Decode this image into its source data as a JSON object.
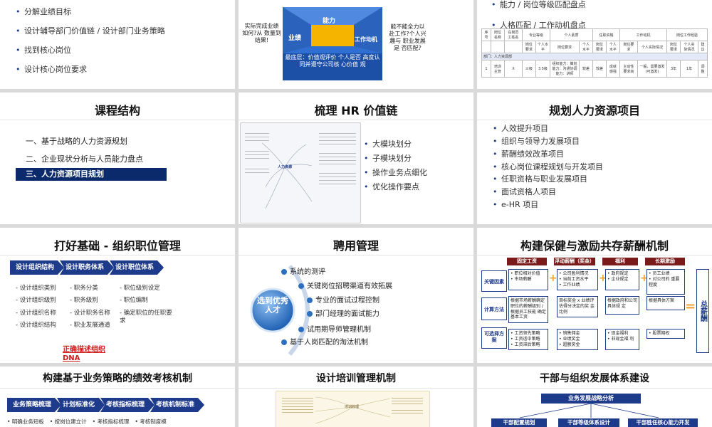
{
  "s1": {
    "items": [
      "分解业绩目标",
      "设计辅导部门价值链 / 设计部门业务策略",
      "找到核心岗位",
      "设计核心岗位要求"
    ]
  },
  "s2": {
    "box_top": "能力",
    "box_left": "业绩",
    "box_right": "工作动机",
    "box_bottom": "最底层：价值观评价 个人是否 高度认同并遵守公司核 心价值 观",
    "left_q": "实际完成业绩如何?从 数量到结果!",
    "right_q": "能不能全力以赴工作?个人兴趣与 职业发展是 否匹配?"
  },
  "s3": {
    "items": [
      "能力 / 岗位等级匹配盘点",
      "人格匹配 / 工作动机盘点"
    ],
    "table_head": [
      "序号",
      "岗位名称",
      "在岗员工姓名",
      "专业等级",
      "个人素质",
      "任职资格",
      "能力匹配",
      "工作动机",
      "岗位工作经验"
    ],
    "table_sub": [
      "岗位要求",
      "个人水平",
      "岗位要求",
      "个人水平",
      "岗位要求",
      "个人水平",
      "岗位要求",
      "个人实际情况",
      "岗位要求",
      "个人实际情况",
      "建议"
    ],
    "dept_row": "部门：人力资源部",
    "row": [
      "1",
      "培训主管",
      "X",
      "三级",
      "3.5级",
      "组织能力：策划能力：沟通协调 能力：讲师",
      "较差",
      "较差",
      "成就感强",
      "主动性要求高",
      "一般，需要激发(可激发)",
      "3年",
      "1年",
      "调整"
    ]
  },
  "s4": {
    "title": "课程结构",
    "items": [
      "一、基于战略的人力资源规划",
      "二、企业现状分析与人员能力盘点",
      "三、人力资源项目规划"
    ]
  },
  "s5": {
    "title": "梳理 HR 价值链",
    "items": [
      "大模块划分",
      "子模块划分",
      "操作业务点细化",
      "优化操作要点"
    ],
    "center_node": "人力资源"
  },
  "s6": {
    "title": "规划人力资源项目",
    "items": [
      "人效提升项目",
      "组织与领导力发展项目",
      "薪酬绩效改革项目",
      "核心岗位课程规划与开发项目",
      "任职资格与职业发展项目",
      "面试资格人项目",
      "e-HR 项目"
    ]
  },
  "s7": {
    "title": "打好基础 - 组织职位管理",
    "steps": [
      "设计组织结构",
      "设计职务体系",
      "设计职位体系"
    ],
    "col1": [
      "设计组织类别",
      "设计组织级别",
      "设计组织名称",
      "设计组织结构"
    ],
    "col2": [
      "职务分类",
      "职务级别",
      "设计职务名称",
      "职业发展通道"
    ],
    "col3": [
      "职位级别设定",
      "职位编制",
      "确定职位的任职要求"
    ],
    "footer": "正确描述组织DNA"
  },
  "s8": {
    "title": "聘用管理",
    "center": "选到优秀人才",
    "items": [
      "系统的测评",
      "关键岗位招聘渠道有效拓展",
      "专业的面试过程控制",
      "部门经理的面试能力",
      "试用期导师管理机制",
      "基于人岗匹配的淘汰机制"
    ]
  },
  "s9": {
    "title": "构建保健与激励共存薪酬机制",
    "heads": [
      "固定工资",
      "浮动薪酬（奖金）",
      "福利",
      "长期激励"
    ],
    "rows": [
      "关键因素",
      "计算方法",
      "可选择方案"
    ],
    "cells": [
      [
        "职位相对价值",
        "市场薪酬",
        "公司盈利情况",
        "当前工资水平",
        "工作业绩",
        "政府规定",
        "企业规定",
        "员工业绩",
        "对公司的 重要程度"
      ],
      [
        "根据市场薪酬确定职位的薪酬级别 / 根据员工技能 确定基本工资",
        "目标奖金 x 业绩评 估得分决定的奖 金比例",
        "根据政府和公司具体规 定",
        "根据具体方案"
      ],
      [
        "工资领先策略",
        "工资适中策略",
        "工资滞后策略",
        "销售佣金",
        "业绩奖金",
        "超额奖金",
        "现金福利",
        "非现金福 利",
        "股票期权"
      ]
    ],
    "total": "总薪酬"
  },
  "s10": {
    "title": "构建基于业务策略的绩效考核机制",
    "steps": [
      "业务策略梳理",
      "计划标准化",
      "考核指标梳理",
      "考核机制标准"
    ],
    "sub": [
      "明确业务短板",
      "按岗位建立计",
      "考核指标梳理",
      "考核制度模"
    ]
  },
  "s11": {
    "title": "设计培训管理机制",
    "center_node": "培训管理"
  },
  "s12": {
    "title": "干部与组织发展体系建设",
    "top": "业务发展战略分析",
    "boxes": [
      "干部配置规划",
      "干部等级体系设计",
      "干部胜任核心能力开发"
    ]
  }
}
